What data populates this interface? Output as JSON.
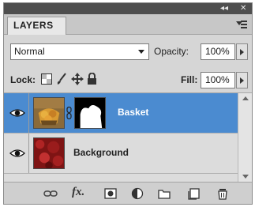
{
  "panel": {
    "titlebar": {
      "collapse_glyph": "◂◂",
      "close_glyph": "✕"
    },
    "tab_label": "LAYERS",
    "blend_mode": "Normal",
    "opacity_label": "Opacity:",
    "opacity_value": "100%",
    "lock_label": "Lock:",
    "fill_label": "Fill:",
    "fill_value": "100%",
    "layers": [
      {
        "name": "Basket",
        "selected": true,
        "visible": true,
        "has_mask": true,
        "icons": [
          "eye-icon",
          "chain-link-icon",
          "layer-mask-thumbnail"
        ]
      },
      {
        "name": "Background",
        "selected": false,
        "visible": true,
        "has_mask": false,
        "icons": [
          "eye-icon"
        ]
      }
    ],
    "lock_icons": [
      "lock-transparent-icon",
      "lock-brush-icon",
      "lock-move-icon",
      "lock-all-icon"
    ],
    "bottom_icons": [
      "link-layers-icon",
      "fx-icon",
      "add-mask-icon",
      "adjustment-layer-icon",
      "new-group-icon",
      "new-layer-icon",
      "trash-icon"
    ],
    "fx_glyph": "fx.",
    "colors": {
      "selection": "#4b8bd0",
      "panel_bg": "#d6d6d6",
      "titlebar": "#4e4e4e"
    }
  }
}
